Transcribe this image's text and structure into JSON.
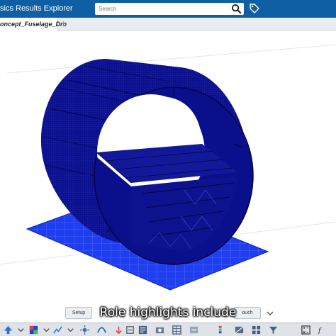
{
  "window": {
    "title": "sics Results Explorer"
  },
  "search": {
    "placeholder": "Search"
  },
  "tabs": [
    {
      "label": "oncept_Fuselage_Dro"
    }
  ],
  "tool_tabs": {
    "setup": "Setup",
    "touch": "ouch"
  },
  "caption": "Role highlights include",
  "colors": {
    "title_bar": "#0e5fa3",
    "mesh_body": "#0a0f8c",
    "ground_plate": "#1f3ef0"
  },
  "icons": {
    "search": "search-icon",
    "tag": "tag-icon",
    "tab_add": "plus-icon"
  }
}
